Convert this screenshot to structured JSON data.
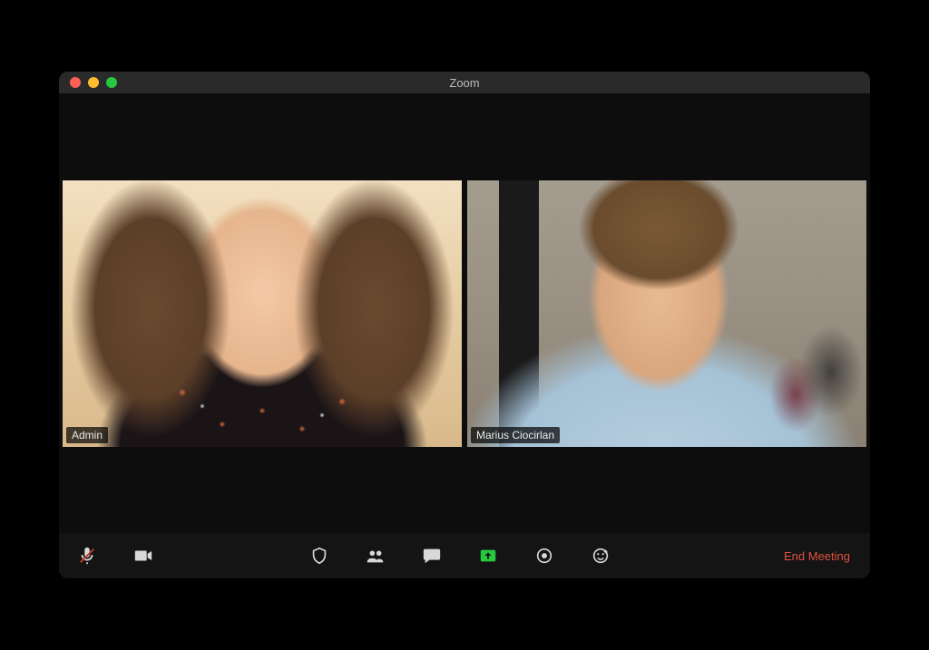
{
  "window": {
    "title": "Zoom"
  },
  "participants": [
    {
      "name": "Admin",
      "active_speaker": true
    },
    {
      "name": "Marius Ciocirlan",
      "active_speaker": false
    }
  ],
  "toolbar": {
    "mute_label": "Mute",
    "mute_muted": true,
    "video_label": "Start Video",
    "security_label": "Security",
    "participants_label": "Participants",
    "chat_label": "Chat",
    "share_label": "Share Screen",
    "record_label": "Record",
    "reactions_label": "Reactions",
    "end_label": "End Meeting"
  },
  "colors": {
    "active_border": "#b5e61d",
    "share_green": "#27c840",
    "end_red": "#e15241"
  }
}
